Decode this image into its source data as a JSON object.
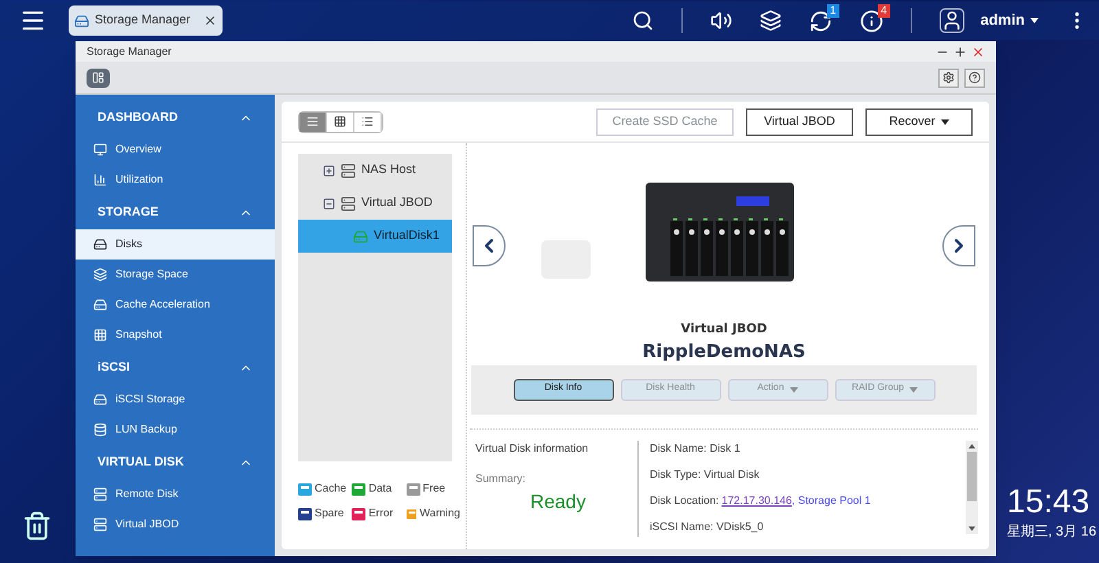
{
  "topbar": {
    "tab": {
      "title": "Storage Manager"
    },
    "user": "admin",
    "badges": [
      {
        "kind": "sync",
        "count": "1"
      },
      {
        "kind": "info",
        "count": "4"
      }
    ]
  },
  "window": {
    "title": "Storage Manager"
  },
  "sidebar": [
    {
      "title": "DASHBOARD",
      "expanded": true,
      "items": [
        {
          "label": "Overview",
          "selected": false
        },
        {
          "label": "Utilization",
          "selected": false
        }
      ]
    },
    {
      "title": "STORAGE",
      "expanded": true,
      "items": [
        {
          "label": "Disks",
          "selected": true
        },
        {
          "label": "Storage Space",
          "selected": false
        },
        {
          "label": "Cache Acceleration",
          "selected": false
        },
        {
          "label": "Snapshot",
          "selected": false
        }
      ]
    },
    {
      "title": "iSCSI",
      "expanded": true,
      "items": [
        {
          "label": "iSCSI Storage",
          "selected": false
        },
        {
          "label": "LUN Backup",
          "selected": false
        }
      ]
    },
    {
      "title": "VIRTUAL DISK",
      "expanded": true,
      "items": [
        {
          "label": "Remote Disk",
          "selected": false
        },
        {
          "label": "Virtual JBOD",
          "selected": false
        }
      ]
    }
  ],
  "view_modes": [
    {
      "kind": "rows",
      "selected": true
    },
    {
      "kind": "grid",
      "selected": false
    },
    {
      "kind": "list",
      "selected": false
    }
  ],
  "actions": [
    {
      "label": "Create SSD Cache",
      "disabled": true,
      "dropdown": false
    },
    {
      "label": "Virtual JBOD",
      "disabled": false,
      "dropdown": false
    },
    {
      "label": "Recover",
      "disabled": false,
      "dropdown": true
    }
  ],
  "tree": [
    {
      "label": "NAS Host",
      "expanded": false,
      "selected": false
    },
    {
      "label": "Virtual JBOD",
      "expanded": true,
      "selected": false,
      "children": [
        {
          "label": "VirtualDisk1",
          "selected": true
        }
      ]
    }
  ],
  "legend": [
    {
      "label": "Cache",
      "color": "#29a8e0"
    },
    {
      "label": "Data",
      "color": "#1ea836"
    },
    {
      "label": "Free",
      "color": "#9a9a9a"
    },
    {
      "label": "Spare",
      "color": "#24408e"
    },
    {
      "label": "Error",
      "color": "#e0245a"
    },
    {
      "label": "Warning",
      "color": "#f0a020"
    }
  ],
  "device": {
    "type": "Virtual JBOD",
    "name": "RippleDemoNAS"
  },
  "disk_buttons": [
    {
      "label": "Disk Info",
      "disabled": false,
      "dropdown": false
    },
    {
      "label": "Disk Health",
      "disabled": true,
      "dropdown": false
    },
    {
      "label": "Action",
      "disabled": true,
      "dropdown": true
    },
    {
      "label": "RAID Group",
      "disabled": true,
      "dropdown": true
    }
  ],
  "info": {
    "title": "Virtual Disk information",
    "summary_label": "Summary:",
    "status": "Ready",
    "lines": [
      {
        "kind": "text",
        "text": "Disk Name: Disk 1"
      },
      {
        "kind": "text",
        "text": "Disk Type: Virtual Disk"
      },
      {
        "kind": "location",
        "text": "Disk Location: ",
        "link": "172.17.30.146",
        "extra": ", Storage Pool 1"
      },
      {
        "kind": "text",
        "text": "iSCSI Name: VDisk5_0"
      }
    ]
  },
  "clock": {
    "time": "15:43",
    "date": "星期三, 3月 16"
  }
}
